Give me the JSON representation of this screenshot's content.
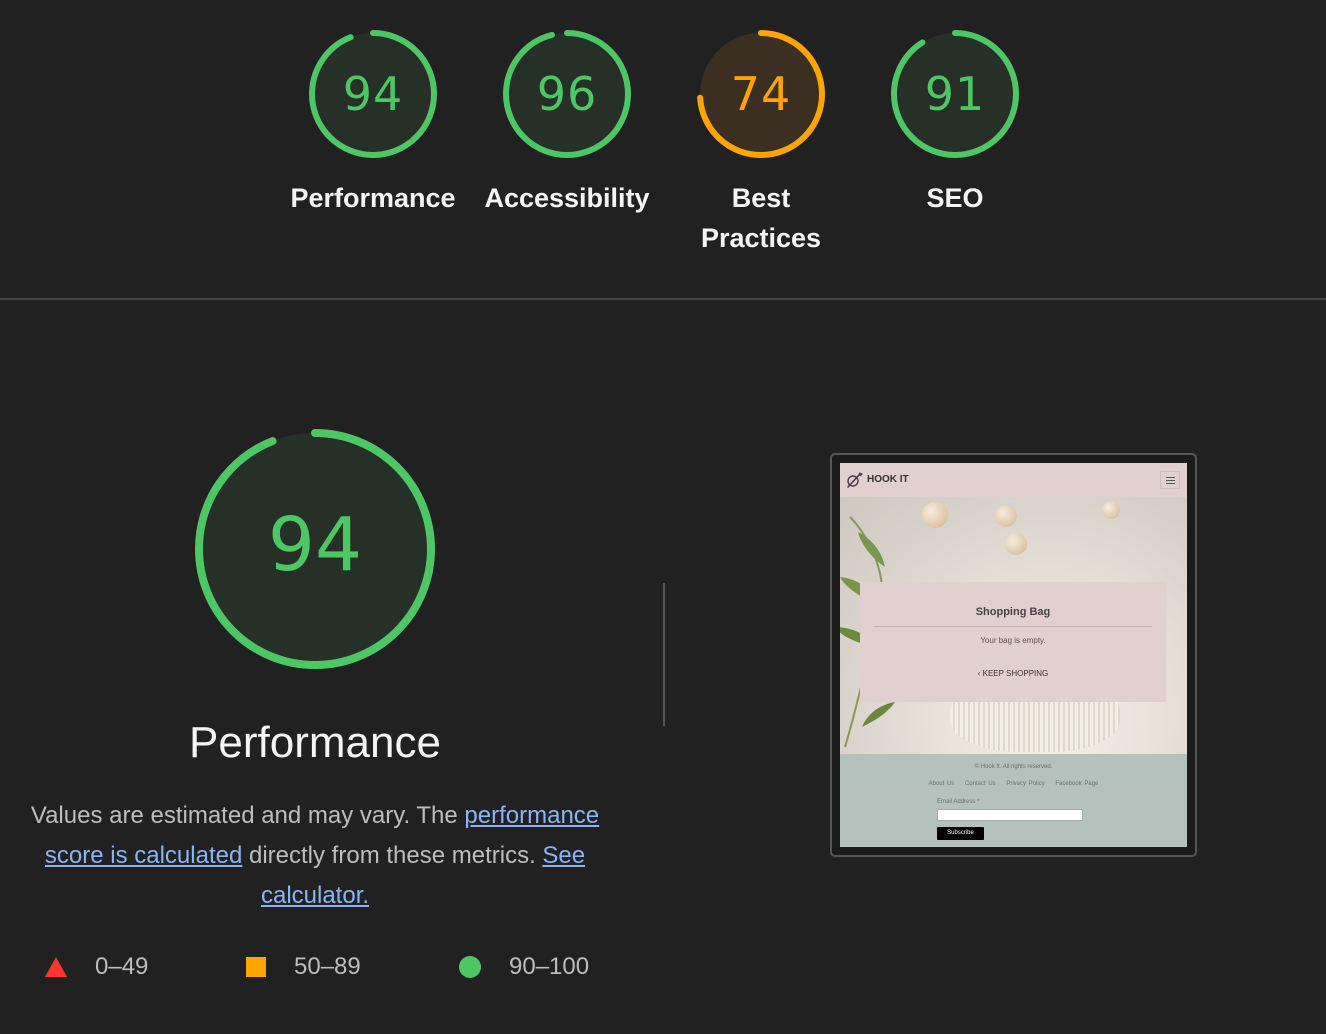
{
  "colors": {
    "pass": "#4cc764",
    "average": "#ffa400",
    "fail": "#ff3333",
    "pass_bg": "#263027",
    "average_bg": "#3a2f20",
    "link": "#8ab4f8"
  },
  "categories": [
    {
      "id": "performance",
      "score": "94",
      "label": "Performance",
      "status": "pass",
      "fraction": 0.94
    },
    {
      "id": "accessibility",
      "score": "96",
      "label": "Accessibility",
      "status": "pass",
      "fraction": 0.96
    },
    {
      "id": "best-practices",
      "score": "74",
      "label_line1": "Best",
      "label_line2": "Practices",
      "status": "average",
      "fraction": 0.74
    },
    {
      "id": "seo",
      "score": "91",
      "label": "SEO",
      "status": "pass",
      "fraction": 0.91
    }
  ],
  "summary": {
    "score": "94",
    "fraction": 0.94,
    "title": "Performance",
    "desc_before": "Values are estimated and may vary. The ",
    "link_score": "performance score is calculated",
    "desc_middle": " directly from these metrics. ",
    "link_calc": "See calculator."
  },
  "legend": [
    {
      "shape": "triangle",
      "range": "0–49"
    },
    {
      "shape": "square",
      "range": "50–89"
    },
    {
      "shape": "circle",
      "range": "90–100"
    }
  ],
  "final_screenshot": {
    "brand": "HOOK IT",
    "bag_title": "Shopping Bag",
    "bag_empty": "Your bag is empty.",
    "keep_shopping": "KEEP SHOPPING",
    "copyright": "© Hook It. All rights reserved.",
    "footer_links": [
      "About Us",
      "Contact Us",
      "Privacy Policy",
      "Facebook Page"
    ],
    "email_label": "Email Address",
    "required_mark": "*",
    "subscribe": "Subscribe"
  }
}
